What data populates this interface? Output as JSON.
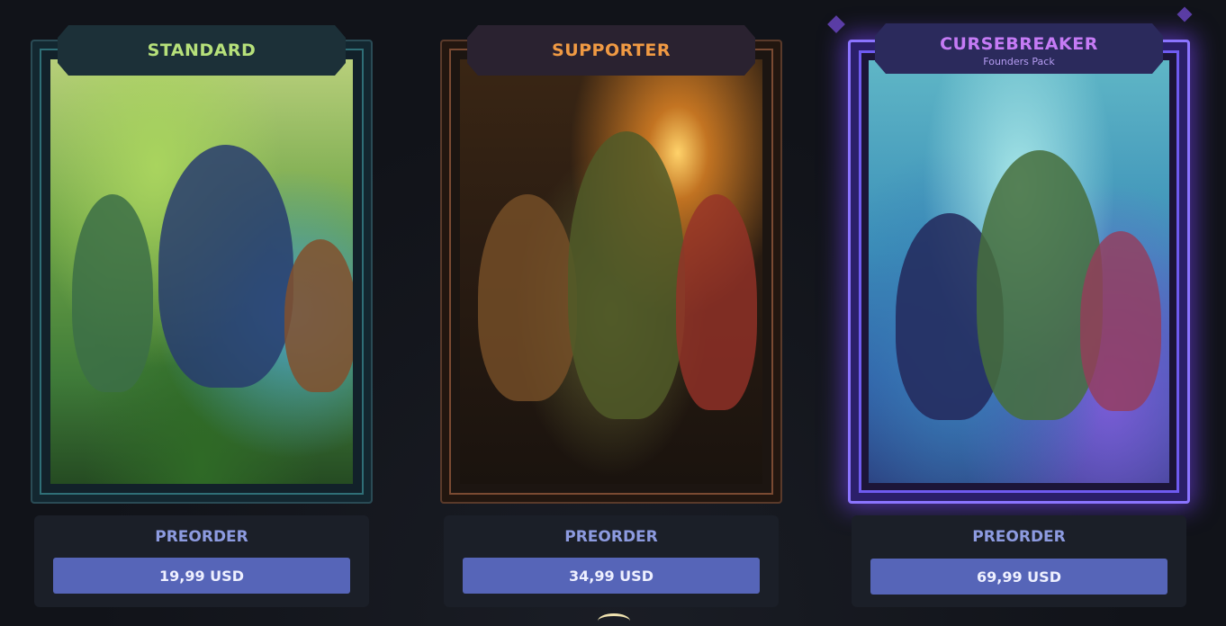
{
  "cards": [
    {
      "tier": "STANDARD",
      "subtitle": "",
      "action_label": "PREORDER",
      "price": "19,99 USD",
      "accent_color": "#b6e07a"
    },
    {
      "tier": "SUPPORTER",
      "subtitle": "",
      "action_label": "PREORDER",
      "price": "34,99 USD",
      "accent_color": "#f09a43"
    },
    {
      "tier": "CURSEBREAKER",
      "subtitle": "Founders Pack",
      "action_label": "PREORDER",
      "price": "69,99 USD",
      "accent_color": "#c57bf5"
    }
  ],
  "button_color": "#5665b8",
  "background_color": "#111319"
}
